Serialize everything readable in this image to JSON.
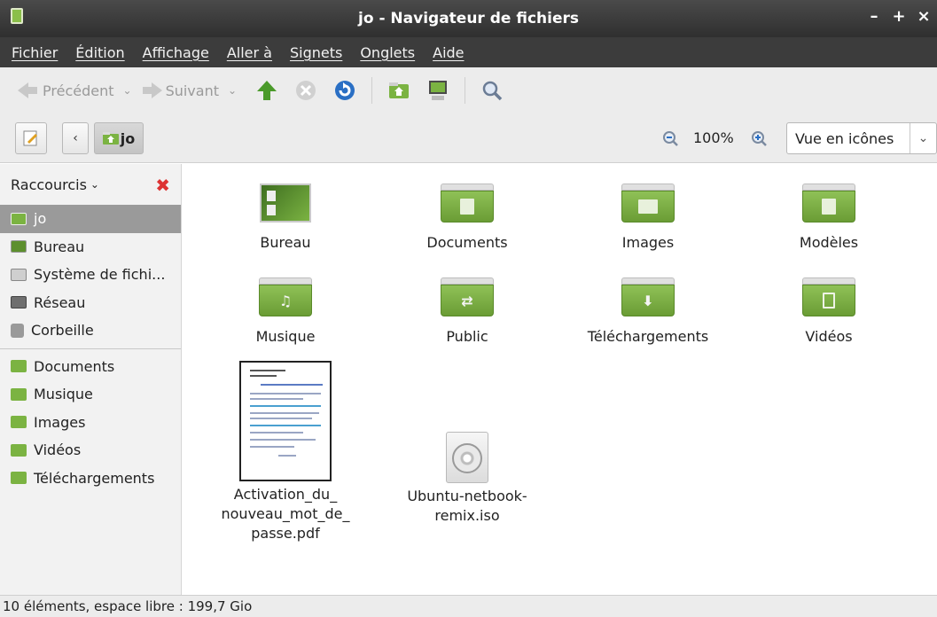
{
  "window": {
    "title": "jo - Navigateur de fichiers",
    "controls": [
      "–",
      "+",
      "×"
    ]
  },
  "menubar": {
    "items": [
      "Fichier",
      "Édition",
      "Affichage",
      "Aller à",
      "Signets",
      "Onglets",
      "Aide"
    ]
  },
  "toolbar": {
    "back_label": "Précédent",
    "forward_label": "Suivant"
  },
  "location": {
    "current": "jo",
    "zoom": "100%",
    "view_mode": "Vue en icônes"
  },
  "sidebar": {
    "header": "Raccourcis",
    "places": [
      {
        "label": "jo",
        "icon": "home-folder-icon",
        "selected": true
      },
      {
        "label": "Bureau",
        "icon": "desktop-icon"
      },
      {
        "label": "Système de fichi...",
        "icon": "filesystem-icon"
      },
      {
        "label": "Réseau",
        "icon": "network-icon"
      },
      {
        "label": "Corbeille",
        "icon": "trash-icon"
      }
    ],
    "bookmarks": [
      {
        "label": "Documents",
        "icon": "documents-folder-icon"
      },
      {
        "label": "Musique",
        "icon": "music-folder-icon"
      },
      {
        "label": "Images",
        "icon": "pictures-folder-icon"
      },
      {
        "label": "Vidéos",
        "icon": "videos-folder-icon"
      },
      {
        "label": "Téléchargements",
        "icon": "downloads-folder-icon"
      }
    ]
  },
  "files": [
    {
      "name": "Bureau",
      "icon": "desktop-icon"
    },
    {
      "name": "Documents",
      "icon": "documents-folder-icon"
    },
    {
      "name": "Images",
      "icon": "pictures-folder-icon"
    },
    {
      "name": "Modèles",
      "icon": "templates-folder-icon"
    },
    {
      "name": "Musique",
      "icon": "music-folder-icon"
    },
    {
      "name": "Public",
      "icon": "public-folder-icon"
    },
    {
      "name": "Téléchargements",
      "icon": "downloads-folder-icon"
    },
    {
      "name": "Vidéos",
      "icon": "videos-folder-icon"
    },
    {
      "name_lines": [
        "Activation_du_",
        "nouveau_mot_de_",
        "passe.pdf"
      ],
      "icon": "pdf-thumbnail"
    },
    {
      "name_lines": [
        "Ubuntu-netbook-",
        "remix.iso"
      ],
      "icon": "disc-image-icon"
    }
  ],
  "statusbar": {
    "text": "10 éléments, espace libre : 199,7 Gio"
  },
  "colors": {
    "folder_green": "#7bb342",
    "titlebar": "#3c3c3c",
    "selection": "#9a9a9a"
  }
}
